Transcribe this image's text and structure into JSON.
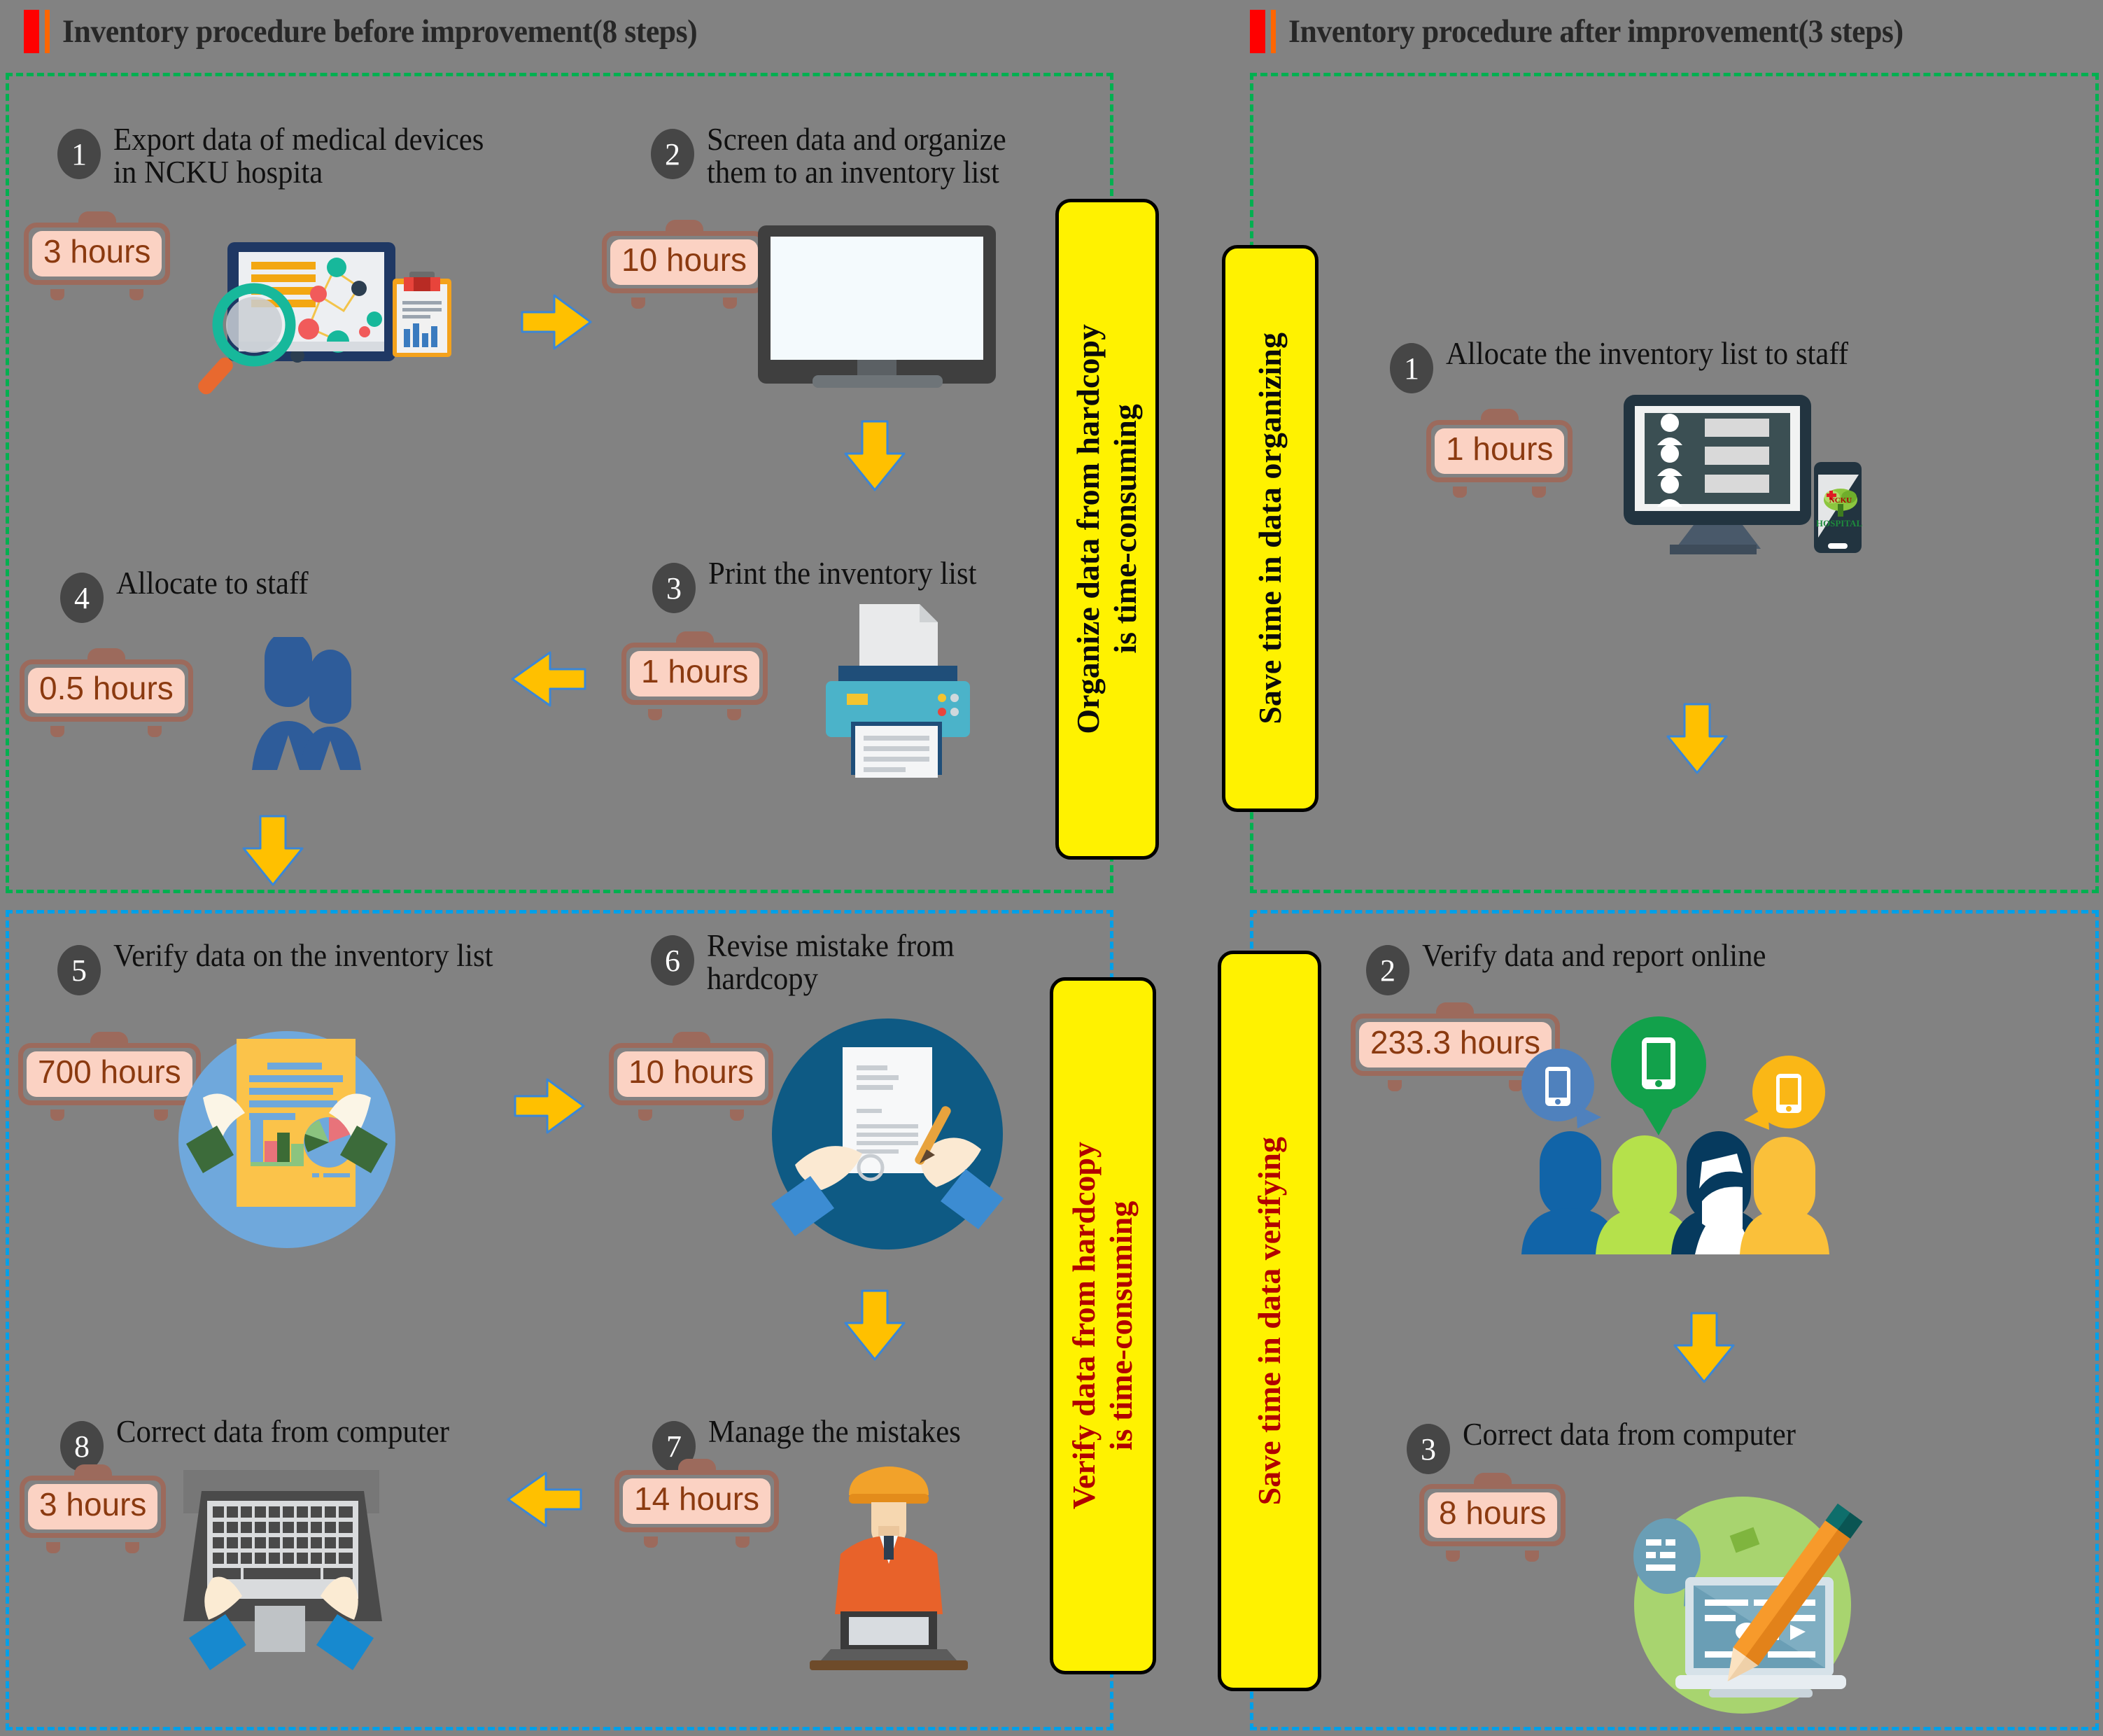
{
  "titles": {
    "left": "Inventory procedure before improvement(8 steps)",
    "right": "Inventory procedure after improvement(3 steps)"
  },
  "colors": {
    "background": "#828282",
    "panel_green": "#00B050",
    "panel_blue": "#00A0E9",
    "badge_grey": "#464646",
    "hours_fill": "#FBD2C3",
    "hours_text": "#8B3A10",
    "hours_frame": "#9C6A5C",
    "banner_yellow": "#FFF200",
    "banner_text_dark": "#0B0B0B",
    "banner_text_red": "#B00000",
    "arrow_yellow": "#FFC000",
    "title_red": "#FF0000",
    "title_orange": "#FF6600"
  },
  "before": {
    "steps": [
      {
        "number": "1",
        "title": "Export data of medical devices\nin NCKU hospita",
        "hours": "3 hours",
        "icon": "data-export-icon"
      },
      {
        "number": "2",
        "title": "Screen data and organize\nthem to an inventory list",
        "hours": "10 hours",
        "icon": "monitor-icon"
      },
      {
        "number": "3",
        "title": "Print the inventory list",
        "hours": "1 hours",
        "icon": "printer-icon"
      },
      {
        "number": "4",
        "title": "Allocate to staff",
        "hours": "0.5 hours",
        "icon": "staff-icon"
      },
      {
        "number": "5",
        "title": "Verify data on the inventory list",
        "hours": "700 hours",
        "icon": "report-review-icon"
      },
      {
        "number": "6",
        "title": "Revise mistake from\nhardcopy",
        "hours": "10 hours",
        "icon": "document-revise-icon"
      },
      {
        "number": "7",
        "title": "Manage the mistakes",
        "hours": "14 hours",
        "icon": "worker-laptop-icon"
      },
      {
        "number": "8",
        "title": "Correct data from computer",
        "hours": "3 hours",
        "icon": "keyboard-typing-icon"
      }
    ]
  },
  "after": {
    "steps": [
      {
        "number": "1",
        "title": "Allocate the inventory list to staff",
        "hours": "1 hours",
        "icon": "monitor-phone-icon"
      },
      {
        "number": "2",
        "title": "Verify data and report online",
        "hours": "233.3 hours",
        "icon": "people-mobile-icon"
      },
      {
        "number": "3",
        "title": "Correct data from computer",
        "hours": "8 hours",
        "icon": "laptop-pencil-icon"
      }
    ]
  },
  "banners": {
    "organize": "Organize  data from hardcopy\nis time-consuming",
    "save_organizing": "Save time in data organizing",
    "verify": "Verify data from hardcopy\nis time-consuming",
    "save_verifying": "Save time in data verifying"
  },
  "phone_logo": {
    "line1": "NCKU",
    "line2": "HOSPITAL"
  }
}
